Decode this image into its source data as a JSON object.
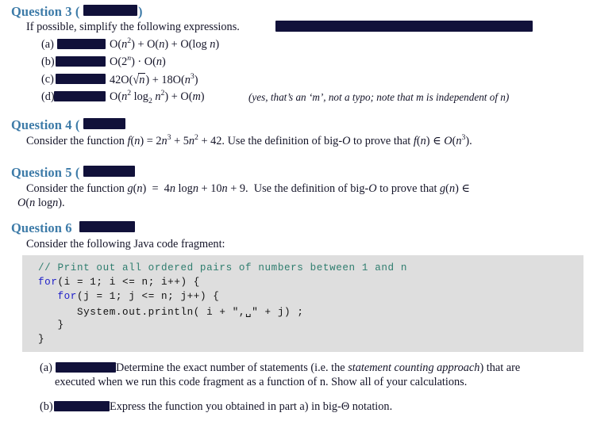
{
  "document": {
    "kind": "assignment-worksheet-scan",
    "accent_heading_color": "#3d7ba8",
    "redaction_color": "#11113a",
    "code_background_color": "#dedede"
  },
  "question3": {
    "heading": "Question 3 (",
    "heading_tail": ")",
    "intro": "If possible, simplify the following expressions.",
    "items": [
      {
        "label": "(a)",
        "expression_plain": "O(n²) + O(n) + O(log n)"
      },
      {
        "label": "(b)",
        "expression_plain": "O(2ⁿ) · O(n)"
      },
      {
        "label": "(c)",
        "expression_plain": "42O(√n) + 18O(n³)"
      },
      {
        "label": "(d)",
        "expression_plain": "O(n² log₂ n²) + O(m)"
      }
    ],
    "note": "(yes, that’s an ‘m’, not a typo; note that m is independent of n)"
  },
  "question4": {
    "heading": "Question 4 (",
    "heading_tail": ")",
    "body_plain": "Consider the function f(n) = 2n³ + 5n² + 42. Use the definition of big-O to prove that f(n) ∈ O(n³)."
  },
  "question5": {
    "heading": "Question 5 (",
    "heading_tail": ")",
    "body_line1_plain": "Consider the function g(n) = 4n log n + 10n + 9.  Use the definition of big-O to prove that g(n) ∈",
    "body_line2_plain": "O(n log n)."
  },
  "question6": {
    "heading": "Question 6",
    "heading_tail": "",
    "intro": "Consider the following Java code fragment:",
    "code": {
      "line1_comment": "// Print out all ordered pairs of numbers between 1 and n",
      "line2_keyword": "for",
      "line2_rest": "(i = 1; i <= n; i++) {",
      "line3_indent": "   ",
      "line3_keyword": "for",
      "line3_rest": "(j = 1; j <= n; j++) {",
      "line4": "      System.out.println( i + \",␣\" + j) ;",
      "line5": "   }",
      "line6": "}"
    },
    "parts": [
      {
        "label": "(a)",
        "text_line1_a": "Determine the exact number of statements (i.e. the ",
        "text_line1_em": "statement counting approach",
        "text_line1_b": ") that are",
        "text_line2": "executed when we run this code fragment as a function of n. Show all of your calculations."
      },
      {
        "label": "(b)",
        "text": "Express the function you obtained in part a) in big-Θ notation."
      }
    ]
  },
  "redactions": {
    "count": 10,
    "description": "black marker bars covering point values and one inline sentence"
  }
}
